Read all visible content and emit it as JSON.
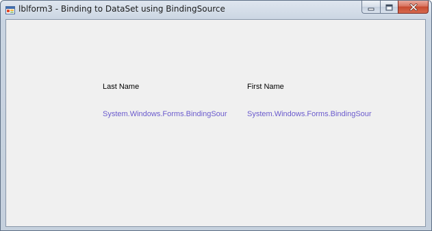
{
  "window": {
    "title": "lblform3 - Binding to DataSet using BindingSource",
    "icon": "windows-form-icon"
  },
  "caption_buttons": {
    "minimize_icon": "minimize-icon",
    "maximize_icon": "maximize-icon",
    "close_icon": "close-icon"
  },
  "form": {
    "last_name_label": "Last Name",
    "first_name_label": "First Name",
    "last_name_value": "System.Windows.Forms.BindingSour",
    "first_name_value": "System.Windows.Forms.BindingSour"
  },
  "colors": {
    "label_text": "#000000",
    "bound_value_text": "#6a5acd",
    "client_background": "#f0f0f0",
    "close_button": "#c74a30"
  }
}
